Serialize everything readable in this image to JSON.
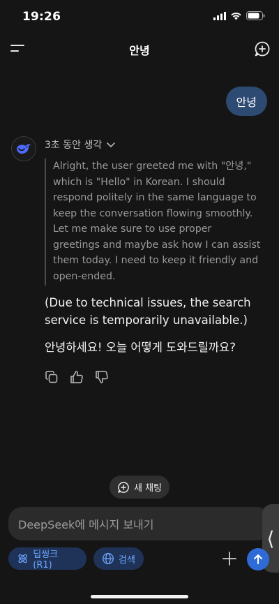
{
  "status": {
    "time": "19:26",
    "icons": [
      "cellular-signal-icon",
      "wifi-icon",
      "battery-icon"
    ]
  },
  "header": {
    "title": "안녕",
    "left_icon": "menu-icon",
    "right_icon": "new-chat-icon"
  },
  "messages": {
    "user": "안녕",
    "assistant": {
      "thinking_label": "3초 동안 생각",
      "thinking_text": "Alright, the user greeted me with \"안녕,\" which is \"Hello\" in Korean. I should respond politely in the same language to keep the conversation flowing smoothly. Let me make sure to use proper greetings and maybe ask how I can assist them today. I need to keep it friendly and open-ended.",
      "notice": "(Due to technical issues, the search service is temporarily unavailable.)",
      "reply": "안녕하세요! 오늘 어떻게 도와드릴까요?"
    }
  },
  "actions": [
    "copy-icon",
    "thumbs-up-icon",
    "thumbs-down-icon"
  ],
  "floating": {
    "new_chat_label": "새 채팅"
  },
  "composer": {
    "placeholder": "DeepSeek에 메시지 보내기",
    "deepthink_label": "딥씽크 (R1)",
    "search_label": "검색",
    "handle_glyph": "⟨"
  },
  "colors": {
    "background": "#151515",
    "user_bubble": "#2d4a73",
    "chip_bg": "#1f3358",
    "chip_text": "#6ea6ff",
    "send_button": "#2f6bd6"
  }
}
